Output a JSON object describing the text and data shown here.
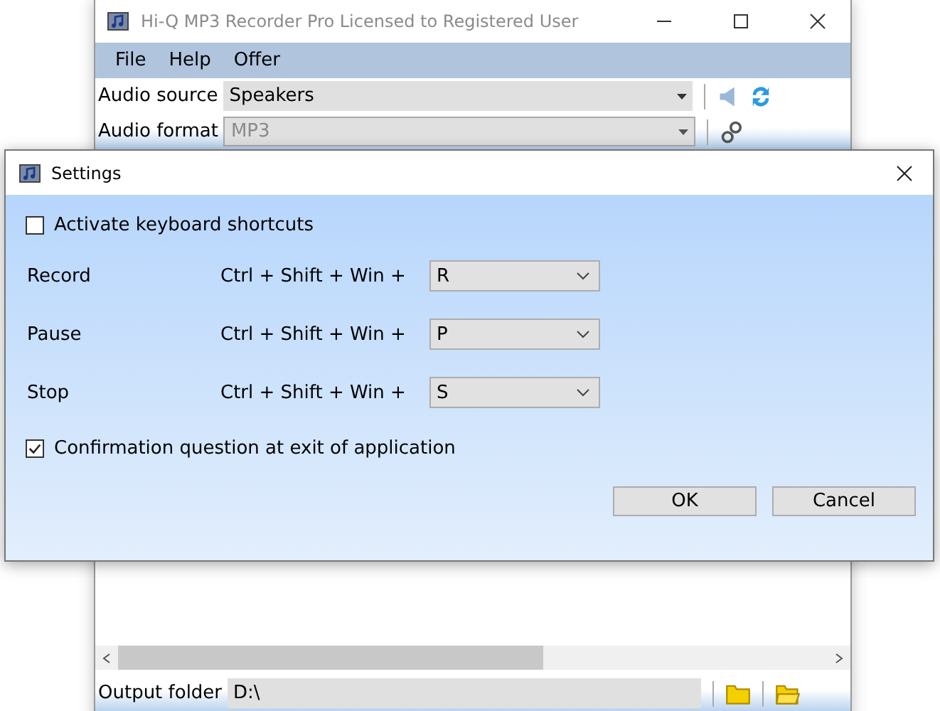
{
  "main_window": {
    "title": "Hi-Q MP3 Recorder Pro Licensed to Registered User",
    "menu": [
      "File",
      "Help",
      "Offer"
    ],
    "audio_source": {
      "label": "Audio source",
      "value": "Speakers",
      "disabled": false
    },
    "audio_format": {
      "label": "Audio format",
      "value": "MP3",
      "disabled": true
    },
    "output_folder": {
      "label": "Output folder",
      "value": "D:\\"
    }
  },
  "settings_dialog": {
    "title": "Settings",
    "shortcuts_checkbox": {
      "label": "Activate keyboard shortcuts",
      "checked": false
    },
    "shortcuts": [
      {
        "action": "Record",
        "combo": "Ctrl + Shift + Win +",
        "key": "R"
      },
      {
        "action": "Pause",
        "combo": "Ctrl + Shift + Win +",
        "key": "P"
      },
      {
        "action": "Stop",
        "combo": "Ctrl + Shift + Win +",
        "key": "S"
      }
    ],
    "confirm_checkbox": {
      "label": "Confirmation question at exit of application",
      "checked": true
    },
    "buttons": [
      "OK",
      "Cancel"
    ]
  }
}
